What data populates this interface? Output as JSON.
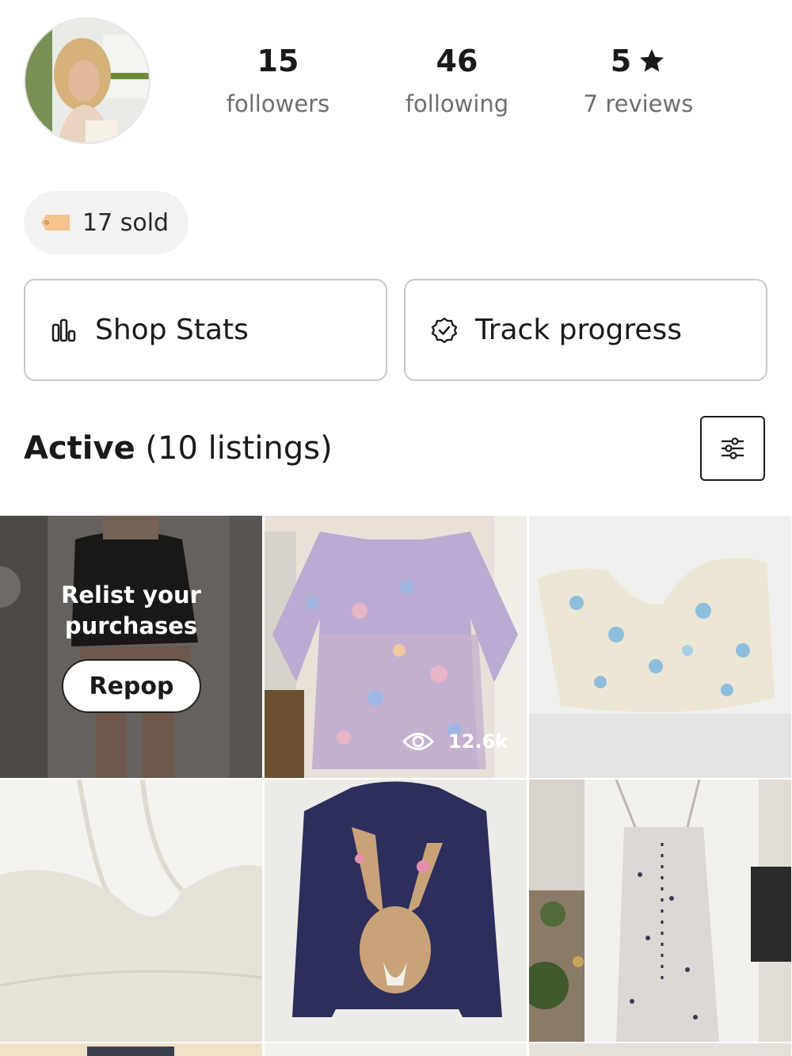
{
  "profile": {
    "stats": [
      {
        "value": "15",
        "label": "followers"
      },
      {
        "value": "46",
        "label": "following"
      },
      {
        "value": "5",
        "label": "7 reviews",
        "icon": "star-icon"
      }
    ],
    "sold_label": "17 sold"
  },
  "actions": {
    "shop_stats": "Shop Stats",
    "track_progress": "Track progress"
  },
  "listings": {
    "title_bold": "Active",
    "title_rest": "(10 listings)",
    "relist_line1": "Relist your",
    "relist_line2": "purchases",
    "repop_label": "Repop",
    "views": "12.6k"
  },
  "colors": {
    "text": "#1a1a1a",
    "muted": "#6e6e6e",
    "pill_bg": "#f2f2f2",
    "tag": "#f6c48f"
  }
}
